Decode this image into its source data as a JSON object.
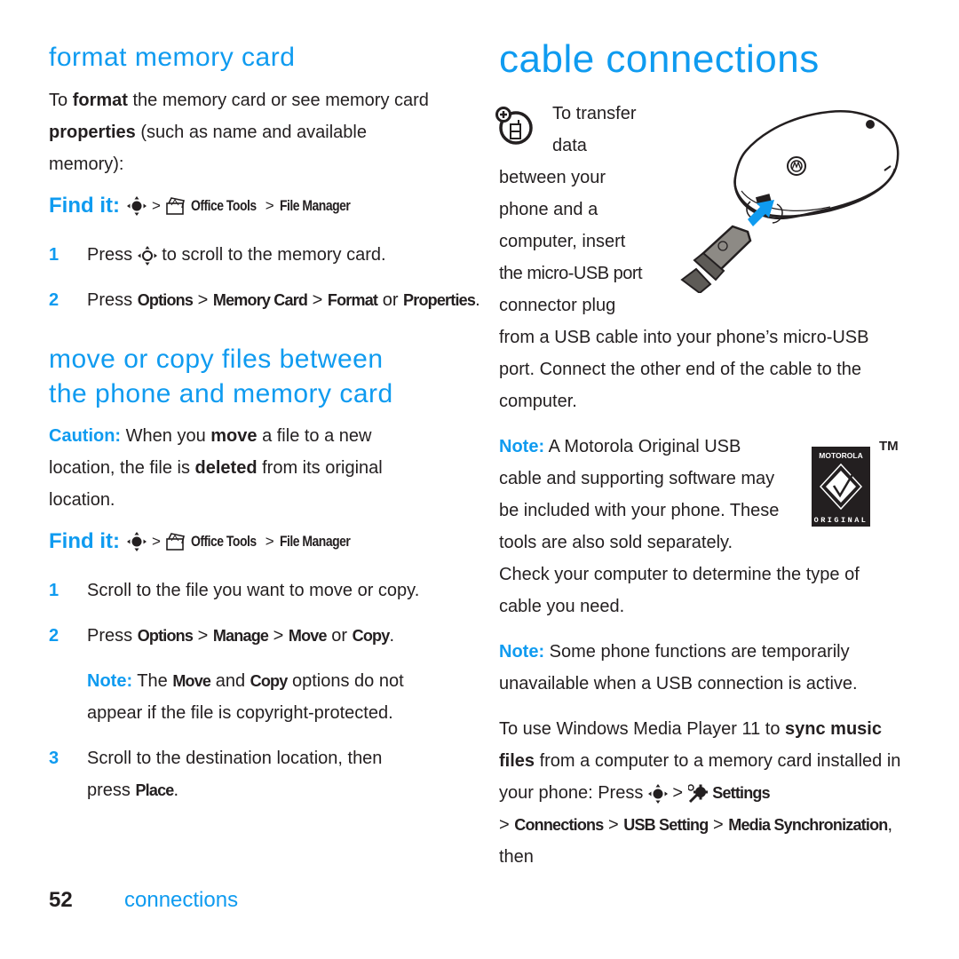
{
  "left": {
    "format_section": {
      "heading": "format memory card",
      "intro_parts": [
        "To ",
        "format",
        " the memory card or see memory card ",
        "properties",
        " (such as name and available memory):"
      ],
      "find_it": {
        "label": "Find it:",
        "separator": ">",
        "path": [
          "Office Tools",
          "File Manager"
        ]
      },
      "steps": [
        {
          "num": "1",
          "parts": [
            "Press ",
            " to scroll to the memory card."
          ]
        },
        {
          "num": "2",
          "parts": [
            "Press ",
            "Options",
            " > ",
            "Memory Card",
            " > ",
            "Format",
            " or ",
            "Properties",
            "."
          ]
        }
      ]
    },
    "move_section": {
      "heading_line1": "move or copy files between",
      "heading_line2": "the phone and memory card",
      "caution_label": "Caution:",
      "caution_parts": [
        " When you ",
        "move",
        " a file to a new location, the file is ",
        "deleted",
        " from its original location."
      ],
      "find_it": {
        "label": "Find it:",
        "separator": ">",
        "path": [
          "Office Tools",
          "File Manager"
        ]
      },
      "steps": [
        {
          "num": "1",
          "text": "Scroll to the file you want to move or copy."
        },
        {
          "num": "2",
          "parts": [
            "Press ",
            "Options",
            " > ",
            "Manage",
            " > ",
            "Move",
            " or ",
            "Copy",
            "."
          ]
        },
        {
          "num": "3",
          "parts": [
            "Scroll to the destination location, then press ",
            "Place",
            "."
          ]
        }
      ],
      "note": {
        "label": "Note:",
        "parts": [
          " The ",
          "Move",
          " and ",
          "Copy",
          " options do not appear if the file is copyright-protected."
        ]
      }
    }
  },
  "right": {
    "heading": "cable connections",
    "intro_lines": [
      "To transfer",
      "data",
      "between your",
      "phone and a",
      "computer, insert",
      "the micro-USB port",
      "connector plug"
    ],
    "intro_cont": "from a USB cable into your phone’s micro-USB port. Connect the other end of the cable to the computer.",
    "note1": {
      "label": "Note:",
      "lines": [
        " A Motorola Original USB",
        "cable and supporting software may",
        "be included with your phone. These",
        "tools are also sold separately."
      ]
    },
    "check_text": "Check your computer to determine the type of cable you need.",
    "note2": {
      "label": "Note:",
      "text": " Some phone functions are temporarily unavailable when a USB connection is active."
    },
    "sync": {
      "parts": [
        "To use Windows Media Player 11 to ",
        "sync music files",
        " from a computer to a memory card installed in your phone: Press "
      ],
      "path": [
        "Settings",
        "Connections",
        "USB Setting",
        "Media Synchronization"
      ],
      "tail": ", then"
    },
    "logo": {
      "top_text": "MOTOROLA",
      "bottom_text": "ORIGINAL",
      "tm": "TM"
    }
  },
  "footer": {
    "page_number": "52",
    "section": "connections"
  },
  "colors": {
    "accent": "#0f9bf0",
    "text": "#231f20"
  }
}
